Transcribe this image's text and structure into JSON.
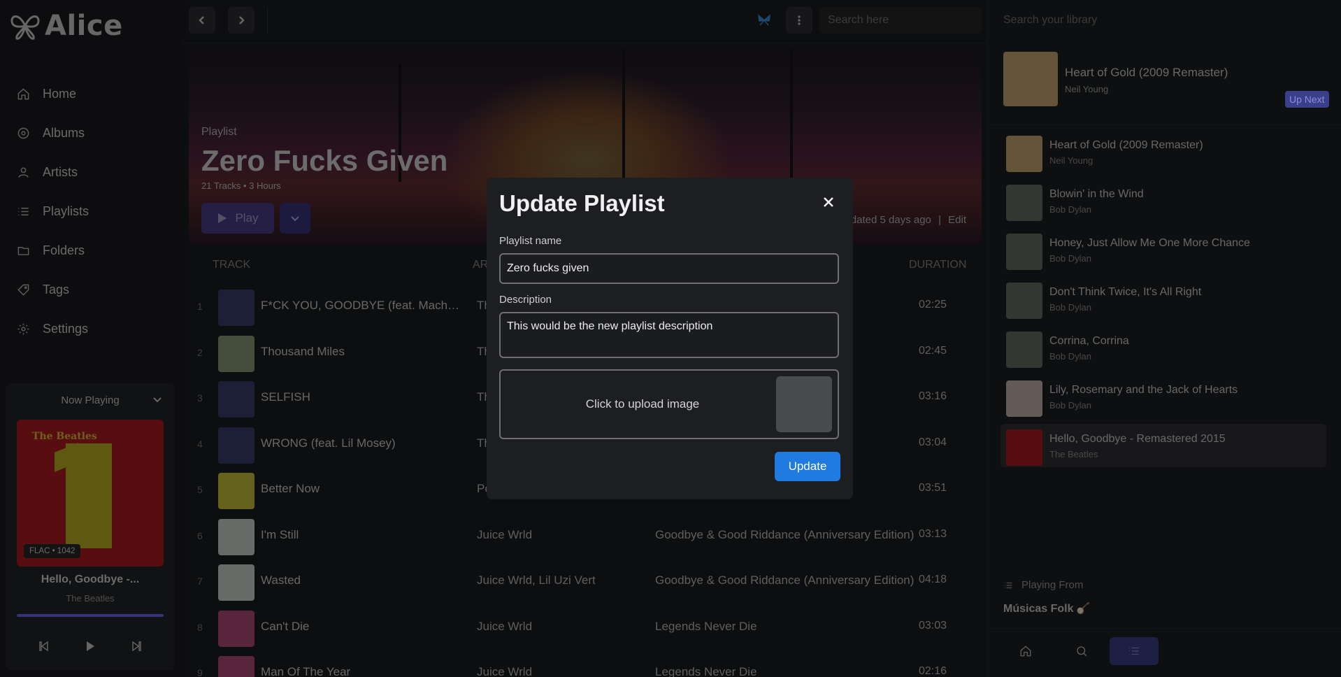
{
  "app": {
    "name": "Alice"
  },
  "colors": {
    "accent": "#1f7be0",
    "purple": "#4b3f8a",
    "modal_bg": "#1d1e21"
  },
  "sidebar": {
    "items": [
      {
        "label": "Home",
        "icon": "home-icon"
      },
      {
        "label": "Albums",
        "icon": "album-icon"
      },
      {
        "label": "Artists",
        "icon": "user-icon"
      },
      {
        "label": "Playlists",
        "icon": "list-icon"
      },
      {
        "label": "Folders",
        "icon": "folder-icon"
      },
      {
        "label": "Tags",
        "icon": "tag-icon"
      },
      {
        "label": "Settings",
        "icon": "gear-icon"
      }
    ]
  },
  "now_playing": {
    "heading": "Now Playing",
    "badge": "FLAC • 1042",
    "title": "Hello, Goodbye -...",
    "artist": "The Beatles",
    "art_text": "The Beatles",
    "progress": 1.0
  },
  "topbar": {
    "search_placeholder": "Search here"
  },
  "hero": {
    "kind": "Playlist",
    "title": "Zero Fucks Given",
    "meta": "21 Tracks • 3 Hours",
    "play_label": "Play",
    "updated": "dated 5 days ago",
    "separator": "|",
    "edit_label": "Edit"
  },
  "table": {
    "headers": {
      "track": "TRACK",
      "artist": "AR",
      "duration": "DURATION"
    },
    "rows": [
      {
        "num": "1",
        "title": "F*CK YOU, GOODBYE (feat. Machine...",
        "artist": "Th",
        "album": "",
        "duration": "02:25",
        "cover": "#3a3f6e"
      },
      {
        "num": "2",
        "title": "Thousand Miles",
        "artist": "Th",
        "album": "",
        "duration": "02:45",
        "cover": "#8a9a7a"
      },
      {
        "num": "3",
        "title": "SELFISH",
        "artist": "Th",
        "album": "",
        "duration": "03:16",
        "cover": "#3a3f6e"
      },
      {
        "num": "4",
        "title": "WRONG (feat. Lil Mosey)",
        "artist": "Th",
        "album": "",
        "duration": "03:04",
        "cover": "#3a3f6e"
      },
      {
        "num": "5",
        "title": "Better Now",
        "artist": "Po",
        "album": "",
        "duration": "03:51",
        "cover": "#c9c23a"
      },
      {
        "num": "6",
        "title": "I'm Still",
        "artist": "Juice Wrld",
        "album": "Goodbye & Good Riddance (Anniversary Edition)",
        "duration": "03:13",
        "cover": "#cfd6cf"
      },
      {
        "num": "7",
        "title": "Wasted",
        "artist": "Juice Wrld, Lil Uzi Vert",
        "album": "Goodbye & Good Riddance (Anniversary Edition)",
        "duration": "04:18",
        "cover": "#cfd6cf"
      },
      {
        "num": "8",
        "title": "Can't Die",
        "artist": "Juice Wrld",
        "album": "Legends Never Die",
        "duration": "03:03",
        "cover": "#b04a7a"
      },
      {
        "num": "9",
        "title": "Man Of The Year",
        "artist": "Juice Wrld",
        "album": "Legends Never Die",
        "duration": "02:16",
        "cover": "#b04a7a"
      }
    ]
  },
  "right_panel": {
    "search_placeholder": "Search your library",
    "current": {
      "title": "Heart of Gold (2009 Remaster)",
      "artist": "Neil Young"
    },
    "up_next_label": "Up Next",
    "queue": [
      {
        "title": "Heart of Gold (2009 Remaster)",
        "artist": "Neil Young",
        "cover": "#c8a974"
      },
      {
        "title": "Blowin' in the Wind",
        "artist": "Bob Dylan",
        "cover": "#6b6e66"
      },
      {
        "title": "Honey, Just Allow Me One More Chance",
        "artist": "Bob Dylan",
        "cover": "#6b6e66"
      },
      {
        "title": "Don't Think Twice, It's All Right",
        "artist": "Bob Dylan",
        "cover": "#6b6e66"
      },
      {
        "title": "Corrina, Corrina",
        "artist": "Bob Dylan",
        "cover": "#6b6e66"
      },
      {
        "title": "Lily, Rosemary and the Jack of Hearts",
        "artist": "Bob Dylan",
        "cover": "#c9b7b0"
      },
      {
        "title": "Hello, Goodbye - Remastered 2015",
        "artist": "The Beatles",
        "cover": "#b11c20"
      }
    ],
    "playing_from_label": "Playing From",
    "playing_from_name": "Músicas Folk 🪕"
  },
  "modal": {
    "title": "Update Playlist",
    "name_label": "Playlist name",
    "name_value": "Zero fucks given",
    "description_label": "Description",
    "description_value": "This would be the new playlist description",
    "upload_label": "Click to upload image",
    "submit_label": "Update"
  }
}
